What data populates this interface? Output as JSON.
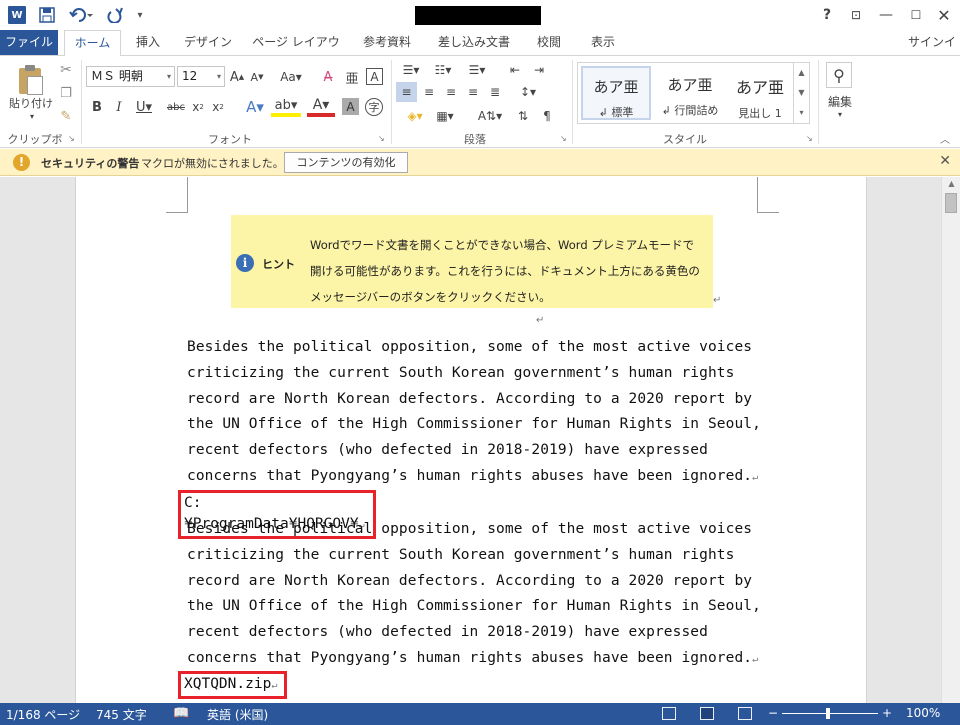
{
  "titlebar": {
    "logo": "W",
    "help": "?",
    "ribbon_opt": "⊡",
    "minimize": "—",
    "maximize": "☐",
    "close": "✕"
  },
  "tabs": {
    "file": "ファイル",
    "home": "ホーム",
    "insert": "挿入",
    "design": "デザイン",
    "page_layout": "ページ レイアウト",
    "references": "参考資料",
    "mailings": "差し込み文書",
    "review": "校閲",
    "view": "表示",
    "signin": "サインイン"
  },
  "ribbon": {
    "clipboard": {
      "paste_label": "貼り付け",
      "group_label": "クリップボード"
    },
    "font": {
      "name": "ＭＳ 明朝",
      "size": "12",
      "group_label": "フォント"
    },
    "paragraph": {
      "group_label": "段落"
    },
    "styles": {
      "group_label": "スタイル",
      "items": [
        {
          "sample": "あア亜",
          "name": "↲ 標準"
        },
        {
          "sample": "あア亜",
          "name": "↲ 行間詰め"
        },
        {
          "sample": "あア亜",
          "name": "見出し 1"
        }
      ]
    },
    "editing": {
      "label": "編集"
    }
  },
  "security_bar": {
    "title": "セキュリティの警告",
    "message": "マクロが無効にされました。",
    "button": "コンテンツの有効化"
  },
  "document": {
    "hint_label": "ヒント",
    "hint_text": "Wordでワード文書を開くことができない場合、Word プレミアムモードで開ける可能性があります。これを行うには、ドキュメント上方にある黄色のメッセージバーのボタンをクリックください。",
    "paragraph_1": "Besides the political opposition, some of the most active voices criticizing the current South Korean government’s human rights record are North Korean defectors. According to a 2020 report by the UN Office of the High Commissioner for Human Rights in Seoul, recent defectors (who defected in 2018-2019) have expressed concerns that Pyongyang’s human rights abuses have been ignored.",
    "path_text": "C:¥ProgramData¥HQRGOV¥",
    "paragraph_2": "Besides the political opposition, some of the most active voices criticizing the current South Korean government’s human rights record are North Korean defectors. According to a 2020 report by the UN Office of the High Commissioner for Human Rights in Seoul, recent defectors (who defected in 2018-2019) have expressed concerns that Pyongyang’s human rights abuses have been ignored.",
    "file_text": "XQTQDN.zip",
    "pilcrow": "↵"
  },
  "statusbar": {
    "page": "1/168 ページ",
    "words": "745 文字",
    "language": "英語 (米国)",
    "zoom": "100%",
    "zoom_minus": "−",
    "zoom_plus": "+"
  },
  "colors": {
    "accent": "#2b579a",
    "highlight_box": "#e8212a",
    "message_bar": "#fff2c4",
    "hint_bg": "#fcf4a6"
  }
}
